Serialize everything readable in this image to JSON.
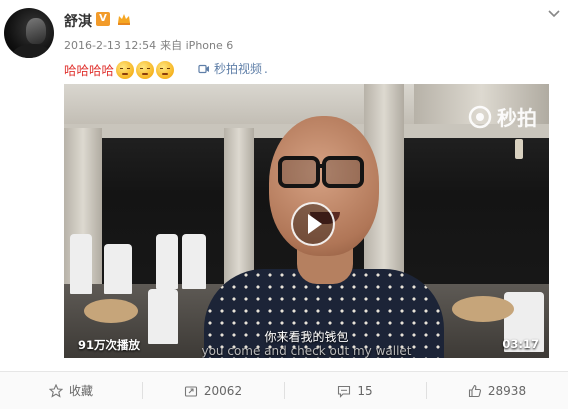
{
  "post": {
    "username": "舒淇",
    "vip_badge": "V",
    "timestamp": "2016-2-13 12:54",
    "source_prefix": "来自",
    "source": "iPhone 6",
    "text": "哈哈哈哈",
    "emoji_count": 3,
    "video_link": "秒拍视频",
    "video_link_suffix": "."
  },
  "video": {
    "watermark": "秒拍",
    "views": "91万次播放",
    "duration": "03:17",
    "subtitle_cn": "你来看我的钱包",
    "subtitle_en": "you come and check out my wallet"
  },
  "actions": {
    "favorite": "收藏",
    "repost": "20062",
    "comment": "15",
    "like": "28938"
  },
  "colors": {
    "post_text": "#e0322e",
    "link": "#5f7fa8",
    "vip_badge": "#f29b2a"
  }
}
